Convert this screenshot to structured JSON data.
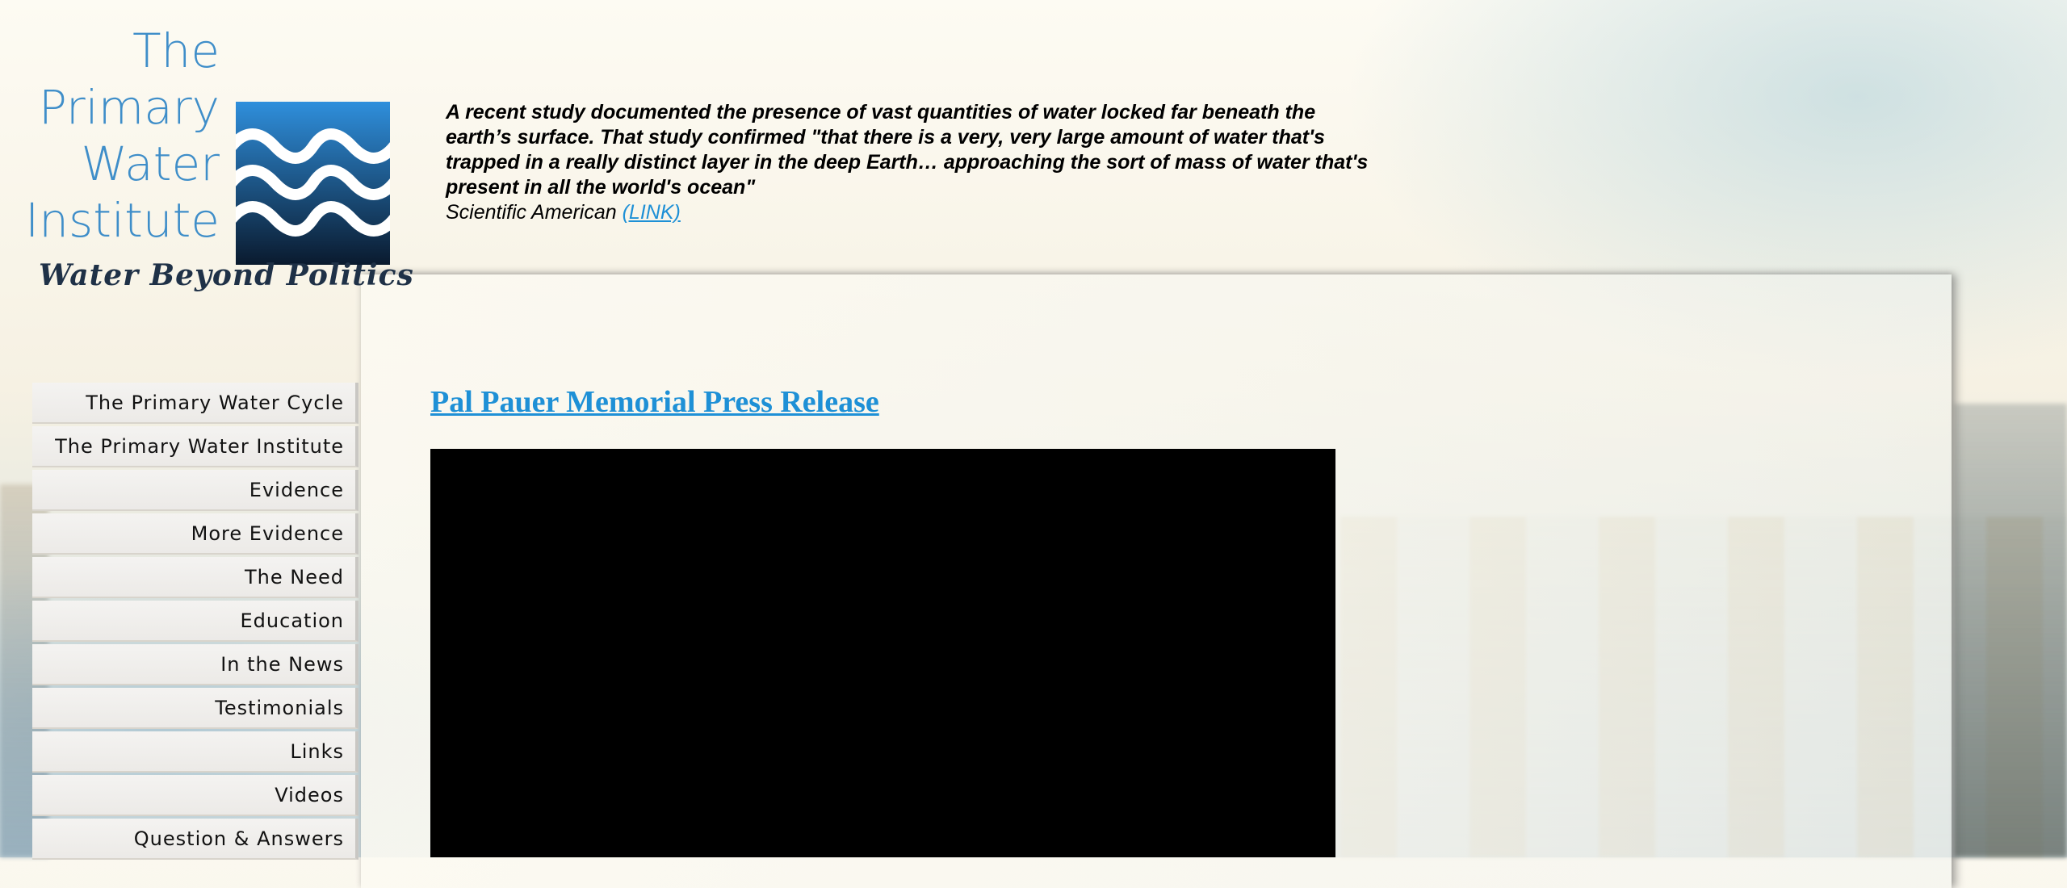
{
  "logo": {
    "lines": [
      "The",
      "Primary",
      "Water",
      "Institute"
    ],
    "tagline": "Water Beyond Politics",
    "icon": "wave-logo-icon",
    "colors": {
      "text": "#3f8ec9",
      "wave_top": "#2f8fdc",
      "wave_bottom": "#0a1a2e"
    }
  },
  "quote": {
    "body": "A recent study documented the presence of vast quantities of water locked far beneath the earth’s surface. That study confirmed \"that there is a very, very large amount of water that's trapped in a really distinct layer in the deep Earth… approaching the sort of mass of water that's present in all the world's ocean\"",
    "source": "Scientific American",
    "link_label": "(LINK)"
  },
  "main": {
    "title": "Pal Pauer Memorial Press Release",
    "link_color": "#1e90d6"
  },
  "nav": {
    "items": [
      {
        "label": "The Primary Water Cycle"
      },
      {
        "label": "The Primary Water Institute"
      },
      {
        "label": "Evidence"
      },
      {
        "label": "More Evidence"
      },
      {
        "label": "The Need"
      },
      {
        "label": "Education"
      },
      {
        "label": "In the News"
      },
      {
        "label": "Testimonials"
      },
      {
        "label": "Links"
      },
      {
        "label": "Videos"
      },
      {
        "label": "Question & Answers"
      }
    ]
  }
}
